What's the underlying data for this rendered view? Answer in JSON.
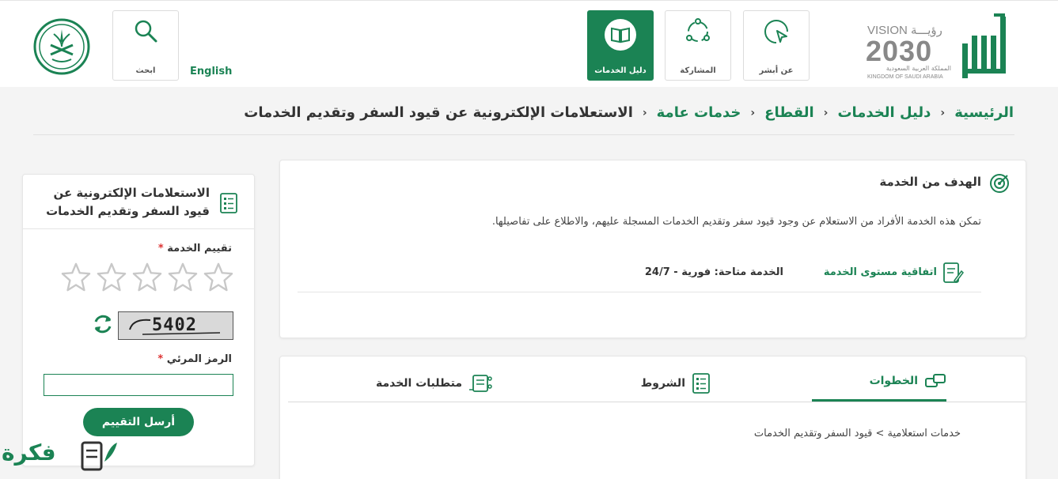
{
  "header": {
    "nav": {
      "about": "عن أبشر",
      "participation": "المشاركة",
      "services_guide": "دليل الخدمات",
      "search": "ابحث"
    },
    "language_link": "English",
    "vision": {
      "line1": "VISION رؤيـــة",
      "year": "2030",
      "kingdom_ar": "المملكة العربية السعودية",
      "kingdom_en": "KINGDOM OF SAUDI ARABIA"
    }
  },
  "breadcrumb": {
    "items": [
      "الرئيسية",
      "دليل الخدمات",
      "القطاع",
      "خدمات عامة"
    ],
    "current": "الاستعلامات الإلكترونية عن قيود السفر وتقديم الخدمات"
  },
  "goal": {
    "title": "الهدف من الخدمة",
    "description": "تمكن هذه الخدمة الأفراد من الاستعلام عن وجود قيود سفر وتقديم الخدمات المسجلة عليهم، والاطلاع على تفاصيلها.",
    "sla_link": "اتفاقية مستوى الخدمة",
    "availability": "الخدمة متاحة: فورية - 24/7"
  },
  "tabs": {
    "steps": "الخطوات",
    "conditions": "الشروط",
    "requirements": "متطلبات الخدمة",
    "steps_content": "خدمات استعلامية > قيود السفر وتقديم الخدمات"
  },
  "side": {
    "title": "الاستعلامات الإلكترونية عن قيود السفر وتقديم الخدمات",
    "rating_label": "تقييم الخدمة",
    "required_mark": "*",
    "rating": {
      "value": 0,
      "max": 5
    },
    "captcha": "5402",
    "code_label": "الرمز المرئي",
    "submit": "أرسل التقييم"
  },
  "watermark": "فكرة",
  "colors": {
    "brand": "#1b8354",
    "required": "#dd3333"
  }
}
